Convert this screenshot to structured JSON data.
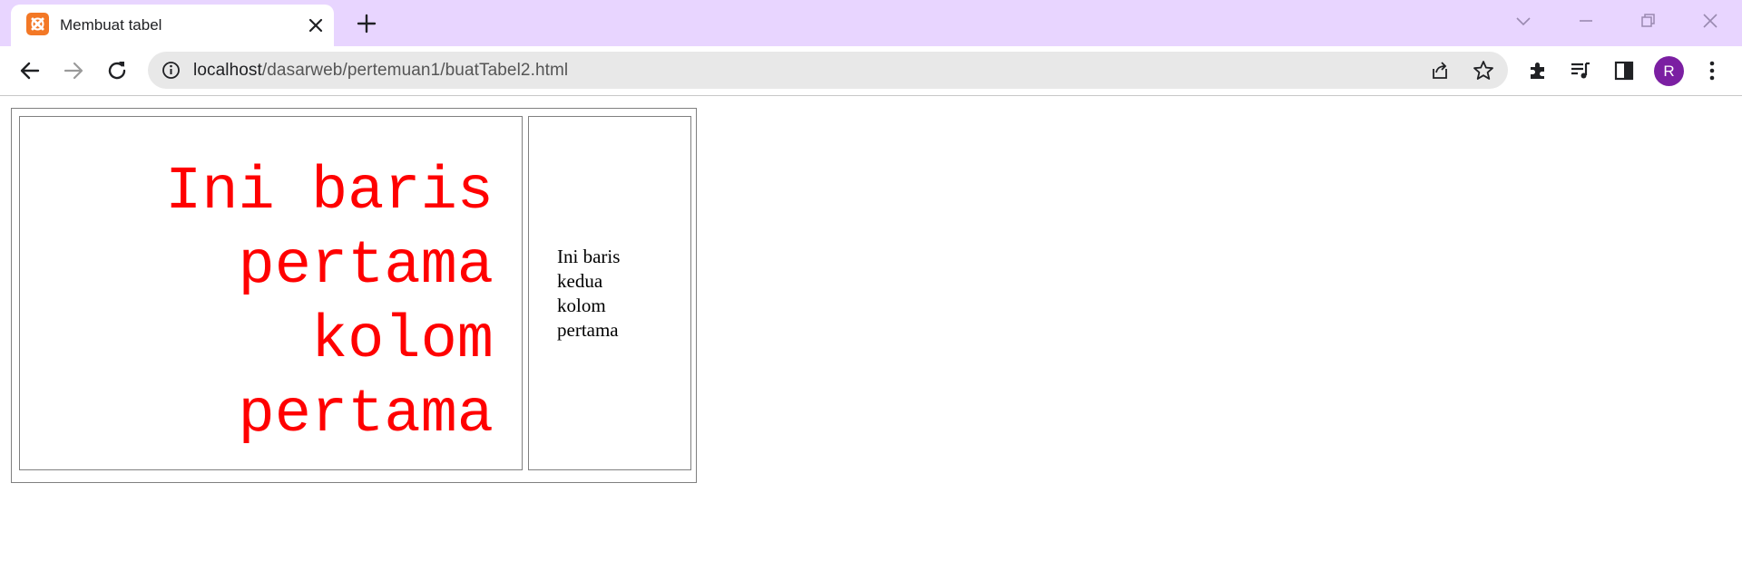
{
  "browser": {
    "tab_title": "Membuat tabel",
    "tab_favicon": "xampp-icon",
    "omnibox": {
      "host": "localhost",
      "path": "/dasarweb/pertemuan1/buatTabel2.html"
    },
    "profile_initial": "R",
    "colors": {
      "tabstrip": "#e8d5ff",
      "avatar": "#7b1fa2",
      "favicon": "#f37826"
    }
  },
  "page": {
    "table": {
      "cell_1_text": "Ini baris\npertama\nkolom\npertama",
      "cell_1_color": "#ff0000",
      "cell_2_text": "Ini baris\nkedua\nkolom\npertama"
    }
  }
}
